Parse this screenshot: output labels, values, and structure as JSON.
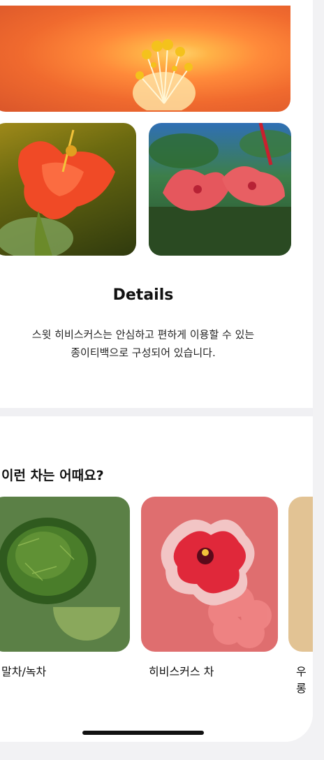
{
  "details": {
    "title": "Details",
    "line1": "스윗 히비스커스는 안심하고 편하게 이용할 수 있는",
    "line2": "종이티백으로 구성되어 있습니다."
  },
  "recommend": {
    "title": "이런 차는 어때요?",
    "cards": [
      {
        "label": "말차/녹차",
        "color": "#5b8046"
      },
      {
        "label": "히비스커스 차",
        "color": "#df6e6f"
      },
      {
        "label": "우롱",
        "color": "#e2c394"
      }
    ]
  }
}
